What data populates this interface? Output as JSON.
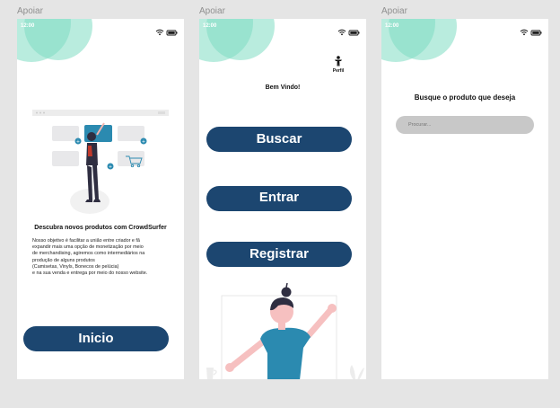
{
  "screens": [
    {
      "label": "Apoiar",
      "time": "12:00",
      "heading": "Descubra novos produtos com CrowdSurfer",
      "paragraph": "Nosso objetivo é facilitar a união entre criador e fã\n expandir mais uma opção de monetização por meio\n de merchandising, agiremos como intermediários na\n produção de alguns produtos\n(Camisetas, Vinyls, Bonecos de pelúcia)\ne na sua venda e entrega por meio do nosso website.",
      "button": "Inicio"
    },
    {
      "label": "Apoiar",
      "time": "12:00",
      "profile_label": "Perfil",
      "welcome": "Bem Vindo!",
      "buttons": {
        "search": "Buscar",
        "login": "Entrar",
        "register": "Registrar"
      }
    },
    {
      "label": "Apoiar",
      "time": "12:00",
      "heading": "Busque o produto que deseja",
      "search_placeholder": "Procurar..."
    }
  ],
  "colors": {
    "primary": "#1c4670",
    "accent": "#7fdcc2",
    "illustration_blue": "#2b8ab0"
  }
}
